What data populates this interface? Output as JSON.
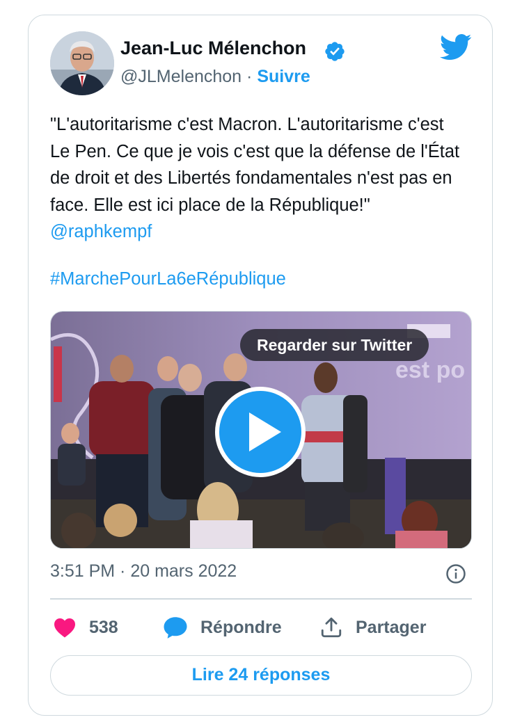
{
  "author": {
    "name": "Jean-Luc Mélenchon",
    "handle": "@JLMelenchon",
    "separator": " · ",
    "follow_label": "Suivre",
    "verified": true
  },
  "tweet": {
    "text": "\"L'autoritarisme c'est Macron. L'autoritarisme c'est Le Pen. Ce que je vois c'est que la défense de l'État de droit et des Libertés fondamentales n'est pas en face. Elle est ici place de la République!\" ",
    "mention": "@raphkempf",
    "hashtag": "#MarchePourLa6eRépublique"
  },
  "media": {
    "watch_label": "Regarder sur Twitter",
    "background_text": "est po"
  },
  "meta": {
    "timestamp": "3:51 PM · 20 mars 2022"
  },
  "actions": {
    "likes": "538",
    "reply_label": "Répondre",
    "share_label": "Partager",
    "read_replies_label": "Lire 24 réponses"
  },
  "colors": {
    "accent": "#1d9bf0",
    "like": "#f91880",
    "muted": "#536471",
    "border": "#cfd9de"
  }
}
